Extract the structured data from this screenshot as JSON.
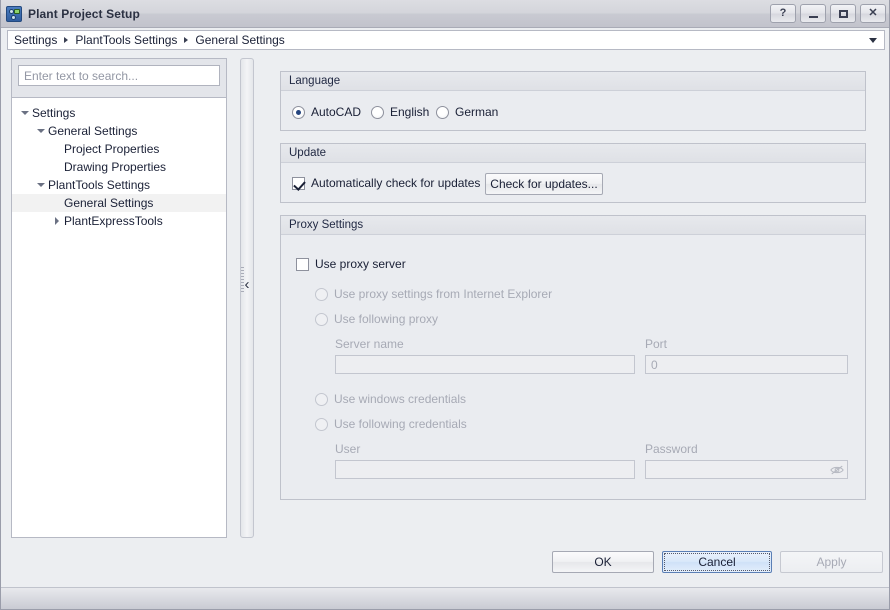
{
  "window": {
    "title": "Plant Project Setup",
    "icon": "plant-project-icon",
    "buttons": [
      {
        "name": "help-button",
        "label": "?"
      },
      {
        "name": "minimize-button",
        "label": ""
      },
      {
        "name": "maximize-button",
        "label": ""
      },
      {
        "name": "close-button",
        "label": "✕"
      }
    ]
  },
  "breadcrumb": {
    "items": [
      "Settings",
      "PlantTools Settings",
      "General Settings"
    ],
    "dropdown_icon": "chevron-down-icon"
  },
  "sidebar": {
    "search": {
      "value": "",
      "placeholder": "Enter text to search..."
    },
    "tree": [
      {
        "label": "Settings",
        "depth": 0,
        "arrow": "down",
        "selected": false
      },
      {
        "label": "General Settings",
        "depth": 1,
        "arrow": "down",
        "selected": false
      },
      {
        "label": "Project Properties",
        "depth": 2,
        "arrow": "none",
        "selected": false
      },
      {
        "label": "Drawing Properties",
        "depth": 2,
        "arrow": "none",
        "selected": false
      },
      {
        "label": "PlantTools Settings",
        "depth": 1,
        "arrow": "down",
        "selected": false
      },
      {
        "label": "General Settings",
        "depth": 2,
        "arrow": "none",
        "selected": true
      },
      {
        "label": "PlantExpressTools",
        "depth": 2,
        "arrow": "right",
        "selected": false
      }
    ]
  },
  "splitter": {
    "collapse_icon": "chevron-left-icon",
    "glyph": "‹"
  },
  "language_group": {
    "title": "Language",
    "options": [
      {
        "label": "AutoCAD",
        "checked": true
      },
      {
        "label": "English",
        "checked": false
      },
      {
        "label": "German",
        "checked": false
      }
    ]
  },
  "update_group": {
    "title": "Update",
    "auto_check": {
      "label": "Automatically check for updates",
      "checked": true
    },
    "check_button": "Check for updates..."
  },
  "proxy_group": {
    "title": "Proxy Settings",
    "use_proxy": {
      "label": "Use proxy server",
      "checked": false
    },
    "source_options": [
      {
        "label": "Use proxy settings from Internet Explorer",
        "checked": false,
        "disabled": true
      },
      {
        "label": "Use following proxy",
        "checked": false,
        "disabled": true
      }
    ],
    "server_name": {
      "label": "Server name",
      "value": ""
    },
    "port": {
      "label": "Port",
      "value": "0"
    },
    "credential_options": [
      {
        "label": "Use windows credentials",
        "checked": false,
        "disabled": true
      },
      {
        "label": "Use following credentials",
        "checked": false,
        "disabled": true
      }
    ],
    "user": {
      "label": "User",
      "value": ""
    },
    "password": {
      "label": "Password",
      "value": "",
      "reveal_icon": "eye-off-icon"
    }
  },
  "footer": {
    "ok": "OK",
    "cancel": "Cancel",
    "apply": "Apply",
    "default_button": "Cancel",
    "disabled_button": "Apply"
  },
  "colors": {
    "window_background": "#eceef1",
    "panel_background": "#eaecf0",
    "tree_background": "#ffffff",
    "selection": "#f2f2f2",
    "accent_radio": "#24447e",
    "default_button_border": "#5b7fb5",
    "disabled_text": "#a7aab5"
  }
}
